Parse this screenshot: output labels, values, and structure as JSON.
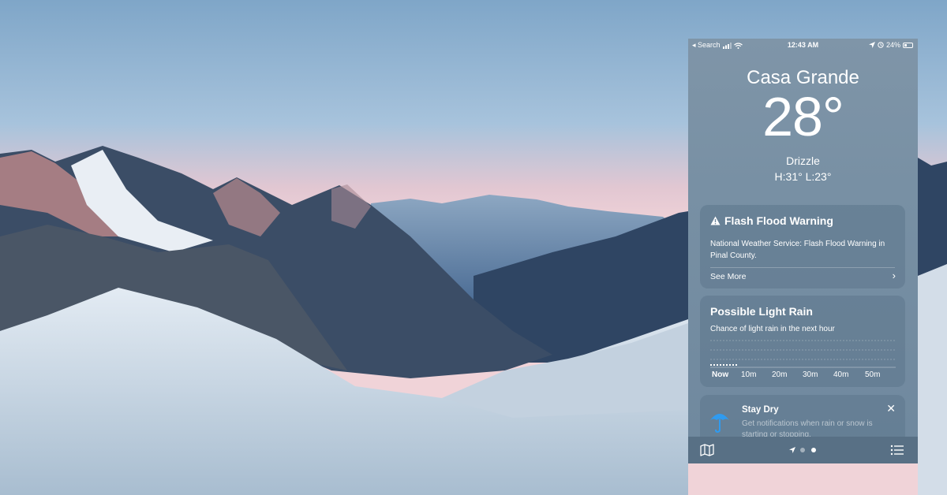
{
  "status_bar": {
    "back_label": "◂ Search",
    "time": "12:43 AM",
    "battery": "24%"
  },
  "weather": {
    "city": "Casa Grande",
    "temperature": "28°",
    "condition": "Drizzle",
    "high_low": "H:31°  L:23°"
  },
  "warning_card": {
    "title": "Flash Flood Warning",
    "body": "National Weather Service: Flash Flood Warning in Pinal County.",
    "see_more": "See More"
  },
  "rain_card": {
    "title": "Possible Light Rain",
    "subtitle": "Chance of light rain in the next hour",
    "time_labels": [
      "Now",
      "10m",
      "20m",
      "30m",
      "40m",
      "50m"
    ]
  },
  "stay_dry_card": {
    "title": "Stay Dry",
    "body": "Get notifications when rain or snow is starting or stopping."
  },
  "icons": {
    "warning": "warning-triangle-icon",
    "umbrella": "umbrella-icon",
    "map": "map-icon",
    "list": "list-icon",
    "location": "location-arrow-icon",
    "close": "close-icon"
  },
  "colors": {
    "umbrella": "#2f9bf0",
    "phone_bg": "#7890a4",
    "card_bg": "#5c768c"
  }
}
